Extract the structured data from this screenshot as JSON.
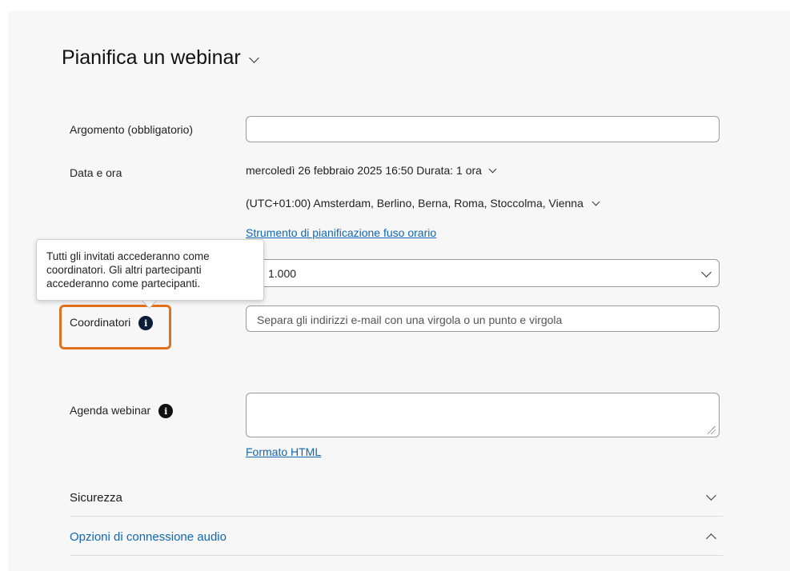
{
  "page": {
    "title": "Pianifica un webinar"
  },
  "form": {
    "topic_label": "Argomento (obbligatorio)",
    "topic_value": "",
    "datetime_label": "Data e ora",
    "datetime_value": "mercoledì 26 febbraio 2025 16:50 Durata: 1 ora",
    "timezone_value": "(UTC+01:00) Amsterdam, Berlino, Berna, Roma, Stoccolma, Vienna",
    "timezone_tool_link": "Strumento di pianificazione fuso orario",
    "attendees_value": "1.000",
    "cohosts_label": "Coordinatori",
    "cohosts_placeholder": "Separa gli indirizzi e-mail con una virgola o un punto e virgola",
    "agenda_label": "Agenda webinar",
    "agenda_value": "",
    "html_format_link": "Formato HTML"
  },
  "tooltip": {
    "text": "Tutti gli invitati accederanno come coordinatori. Gli altri partecipanti accederanno come partecipanti.",
    "line1": "Tutti gli invitati accederanno come",
    "line2": "coordinatori. Gli altri partecipanti",
    "line3": "accederanno come partecipanti."
  },
  "sections": [
    {
      "label": "Sicurezza",
      "expanded": false
    },
    {
      "label": "Opzioni di connessione audio",
      "expanded": true
    }
  ],
  "icons": {
    "info": "info-icon",
    "chevron": "chevron-down-icon"
  },
  "colors": {
    "link": "#1167b1",
    "highlight": "#e2711d",
    "info_icon": "#0c1d3a"
  }
}
